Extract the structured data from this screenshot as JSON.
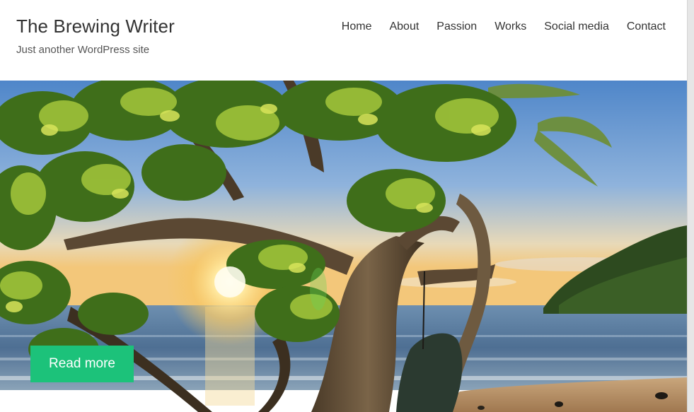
{
  "site": {
    "title": "The Brewing Writer",
    "tagline": "Just another WordPress site"
  },
  "nav": {
    "items": [
      {
        "label": "Home"
      },
      {
        "label": "About"
      },
      {
        "label": "Passion"
      },
      {
        "label": "Works"
      },
      {
        "label": "Social media"
      },
      {
        "label": "Contact"
      }
    ]
  },
  "hero": {
    "cta_label": "Read more",
    "cta_color": "#1cc27a",
    "image_subject": "beach-sunset-tree-photo"
  }
}
